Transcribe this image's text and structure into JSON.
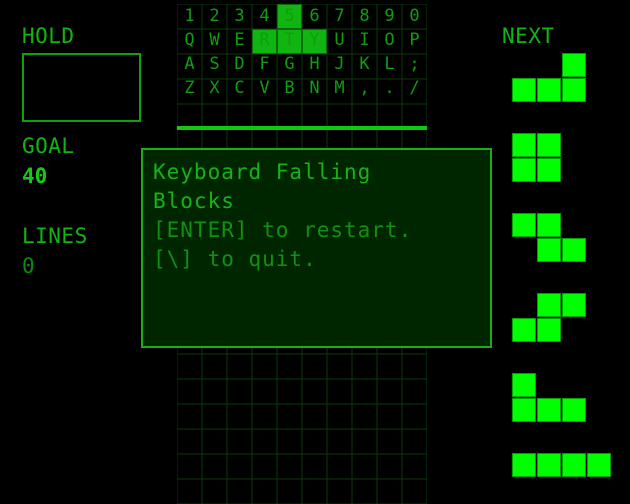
{
  "hold": {
    "label": "HOLD"
  },
  "goal": {
    "label": "GOAL",
    "value": "40"
  },
  "lines": {
    "label": "LINES",
    "value": "0"
  },
  "next": {
    "label": "NEXT",
    "pieces": [
      {
        "name": "L",
        "cells": [
          [
            2,
            0
          ],
          [
            0,
            1
          ],
          [
            1,
            1
          ],
          [
            2,
            1
          ]
        ]
      },
      {
        "name": "O",
        "cells": [
          [
            0,
            0
          ],
          [
            1,
            0
          ],
          [
            0,
            1
          ],
          [
            1,
            1
          ]
        ]
      },
      {
        "name": "Z",
        "cells": [
          [
            0,
            0
          ],
          [
            1,
            0
          ],
          [
            1,
            1
          ],
          [
            2,
            1
          ]
        ]
      },
      {
        "name": "S",
        "cells": [
          [
            1,
            0
          ],
          [
            2,
            0
          ],
          [
            0,
            1
          ],
          [
            1,
            1
          ]
        ]
      },
      {
        "name": "J",
        "cells": [
          [
            0,
            0
          ],
          [
            0,
            1
          ],
          [
            1,
            1
          ],
          [
            2,
            1
          ]
        ]
      },
      {
        "name": "I",
        "cells": [
          [
            0,
            0
          ],
          [
            1,
            0
          ],
          [
            2,
            0
          ],
          [
            3,
            0
          ]
        ]
      }
    ]
  },
  "keyboard": {
    "rows": [
      [
        "1",
        "2",
        "3",
        "4",
        "5",
        "6",
        "7",
        "8",
        "9",
        "0"
      ],
      [
        "Q",
        "W",
        "E",
        "R",
        "T",
        "Y",
        "U",
        "I",
        "O",
        "P"
      ],
      [
        "A",
        "S",
        "D",
        "F",
        "G",
        "H",
        "J",
        "K",
        "L",
        ";"
      ],
      [
        "Z",
        "X",
        "C",
        "V",
        "B",
        "N",
        "M",
        ",",
        ".",
        "/"
      ]
    ],
    "falling_piece": {
      "name": "T",
      "cells": [
        [
          4,
          0
        ],
        [
          3,
          1
        ],
        [
          4,
          1
        ],
        [
          5,
          1
        ]
      ]
    }
  },
  "dialog": {
    "title_line1": "Keyboard Falling",
    "title_line2": "Blocks",
    "line1": "[ENTER] to restart.",
    "line2": "[\\] to quit."
  },
  "colors": {
    "accent": "#00ff00",
    "dim": "#0e880e",
    "grid": "#0a3a0a"
  }
}
